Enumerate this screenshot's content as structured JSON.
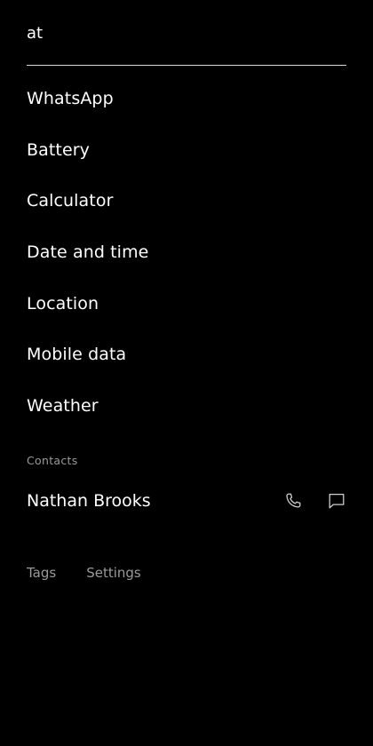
{
  "search": {
    "value": "at",
    "placeholder": ""
  },
  "results": [
    {
      "label": "WhatsApp"
    },
    {
      "label": "Battery"
    },
    {
      "label": "Calculator"
    },
    {
      "label": "Date and time"
    },
    {
      "label": "Location"
    },
    {
      "label": "Mobile data"
    },
    {
      "label": "Weather"
    }
  ],
  "contacts": {
    "section_label": "Contacts",
    "items": [
      {
        "name": "Nathan Brooks",
        "call_icon": "phone-icon",
        "message_icon": "message-icon"
      }
    ]
  },
  "footer": {
    "tags_label": "Tags",
    "settings_label": "Settings"
  },
  "colors": {
    "background": "#000000",
    "text": "#ffffff",
    "muted": "#9a9a9a",
    "divider": "#d9d9d9"
  }
}
